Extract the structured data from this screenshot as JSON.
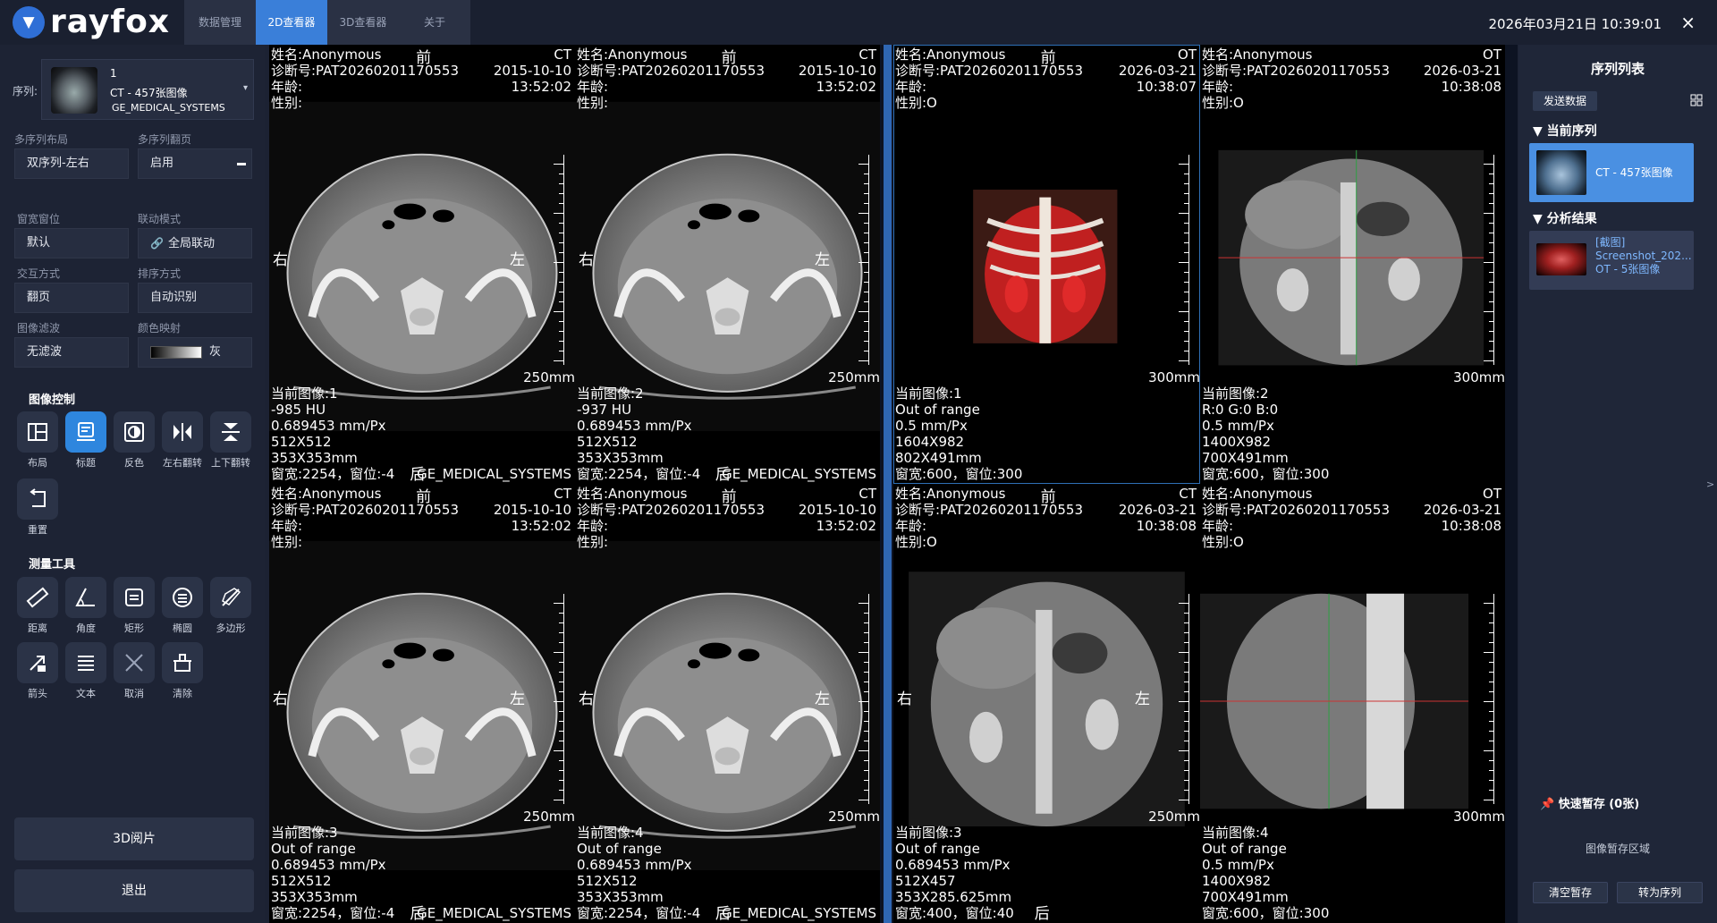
{
  "header": {
    "app_name": "rayfox",
    "tabs": [
      {
        "label": "数据管理"
      },
      {
        "label": "2D查看器"
      },
      {
        "label": "3D查看器"
      },
      {
        "label": "关于"
      }
    ],
    "datetime": "2026年03月21日 10:39:01",
    "close_label": "×"
  },
  "left": {
    "series_label": "序列:",
    "series_number": "1",
    "series_name": "CT - 457张图像",
    "series_vendor": "GE_MEDICAL_SYSTEMS",
    "fields": {
      "multi_layout_label": "多序列布局",
      "multi_layout_value": "双序列-左右",
      "multi_page_label": "多序列翻页",
      "multi_page_value": "启用",
      "window_label": "窗宽窗位",
      "window_value": "默认",
      "link_label": "联动模式",
      "link_value": "全局联动",
      "interact_label": "交互方式",
      "interact_value": "翻页",
      "sort_label": "排序方式",
      "sort_value": "自动识别",
      "filter_label": "图像滤波",
      "filter_value": "无滤波",
      "colormap_label": "颜色映射",
      "colormap_value": "灰"
    },
    "image_control_title": "图像控制",
    "image_tools": [
      {
        "label": "布局",
        "icon": "layout-icon"
      },
      {
        "label": "标题",
        "icon": "caption-icon"
      },
      {
        "label": "反色",
        "icon": "invert-icon"
      },
      {
        "label": "左右翻转",
        "icon": "flip-horizontal-icon"
      },
      {
        "label": "上下翻转",
        "icon": "flip-vertical-icon"
      },
      {
        "label": "重置",
        "icon": "reset-icon"
      }
    ],
    "measure_title": "测量工具",
    "measure_tools": [
      {
        "label": "距离",
        "icon": "ruler-icon"
      },
      {
        "label": "角度",
        "icon": "angle-icon"
      },
      {
        "label": "矩形",
        "icon": "rectangle-icon"
      },
      {
        "label": "椭圆",
        "icon": "ellipse-icon"
      },
      {
        "label": "多边形",
        "icon": "polygon-icon"
      },
      {
        "label": "箭头",
        "icon": "arrow-icon"
      },
      {
        "label": "文本",
        "icon": "text-icon"
      },
      {
        "label": "取消",
        "icon": "cancel-icon"
      },
      {
        "label": "清除",
        "icon": "clear-icon"
      }
    ],
    "btn_3d": "3D阅片",
    "btn_exit": "退出"
  },
  "viewports": [
    {
      "tl1": "姓名:Anonymous",
      "tl2": "诊断号:PAT20260201170553",
      "tl3": "年龄:",
      "tl4": "性别:",
      "top": "前",
      "tr1": "CT",
      "tr2": "2015-10-10",
      "tr3": "13:52:02",
      "left": "右",
      "right": "左",
      "scale_label": "250mm",
      "bl1": "当前图像:1",
      "bl2": "-985 HU",
      "bl3": "0.689453 mm/Px",
      "bl4": "512X512",
      "bl5": "353X353mm",
      "bl6": "窗宽:2254，窗位:-4",
      "bottom": "后",
      "br1": "GE_MEDICAL_SYSTEMS"
    },
    {
      "tl1": "姓名:Anonymous",
      "tl2": "诊断号:PAT20260201170553",
      "tl3": "年龄:",
      "tl4": "性别:",
      "top": "前",
      "tr1": "CT",
      "tr2": "2015-10-10",
      "tr3": "13:52:02",
      "left": "右",
      "right": "左",
      "scale_label": "250mm",
      "bl1": "当前图像:2",
      "bl2": "-937 HU",
      "bl3": "0.689453 mm/Px",
      "bl4": "512X512",
      "bl5": "353X353mm",
      "bl6": "窗宽:2254，窗位:-4",
      "bottom": "后",
      "br1": "GE_MEDICAL_SYSTEMS"
    },
    {
      "tl1": "姓名:Anonymous",
      "tl2": "诊断号:PAT20260201170553",
      "tl3": "年龄:",
      "tl4": "性别:O",
      "top": "前",
      "tr1": "OT",
      "tr2": "2026-03-21",
      "tr3": "10:38:07",
      "left": "",
      "right": "",
      "scale_label": "300mm",
      "bl1": "当前图像:1",
      "bl2": "Out of range",
      "bl3": "0.5 mm/Px",
      "bl4": "1604X982",
      "bl5": "802X491mm",
      "bl6": "窗宽:600，窗位:300",
      "bottom": "",
      "br1": ""
    },
    {
      "tl1": "姓名:Anonymous",
      "tl2": "诊断号:PAT20260201170553",
      "tl3": "年龄:",
      "tl4": "性别:O",
      "top": "",
      "tr1": "OT",
      "tr2": "2026-03-21",
      "tr3": "10:38:08",
      "left": "",
      "right": "",
      "scale_label": "300mm",
      "bl1": "当前图像:2",
      "bl2": "R:0 G:0 B:0",
      "bl3": "0.5 mm/Px",
      "bl4": "1400X982",
      "bl5": "700X491mm",
      "bl6": "窗宽:600，窗位:300",
      "bottom": "",
      "br1": ""
    },
    {
      "tl1": "姓名:Anonymous",
      "tl2": "诊断号:PAT20260201170553",
      "tl3": "年龄:",
      "tl4": "性别:",
      "top": "前",
      "tr1": "CT",
      "tr2": "2015-10-10",
      "tr3": "13:52:02",
      "left": "右",
      "right": "左",
      "scale_label": "250mm",
      "bl1": "当前图像:3",
      "bl2": "Out of range",
      "bl3": "0.689453 mm/Px",
      "bl4": "512X512",
      "bl5": "353X353mm",
      "bl6": "窗宽:2254，窗位:-4",
      "bottom": "后",
      "br1": "GE_MEDICAL_SYSTEMS"
    },
    {
      "tl1": "姓名:Anonymous",
      "tl2": "诊断号:PAT20260201170553",
      "tl3": "年龄:",
      "tl4": "性别:",
      "top": "前",
      "tr1": "CT",
      "tr2": "2015-10-10",
      "tr3": "13:52:02",
      "left": "右",
      "right": "左",
      "scale_label": "250mm",
      "bl1": "当前图像:4",
      "bl2": "Out of range",
      "bl3": "0.689453 mm/Px",
      "bl4": "512X512",
      "bl5": "353X353mm",
      "bl6": "窗宽:2254，窗位:-4",
      "bottom": "后",
      "br1": "GE_MEDICAL_SYSTEMS"
    },
    {
      "tl1": "姓名:Anonymous",
      "tl2": "诊断号:PAT20260201170553",
      "tl3": "年龄:",
      "tl4": "性别:O",
      "top": "前",
      "tr1": "CT",
      "tr2": "2026-03-21",
      "tr3": "10:38:08",
      "left": "右",
      "right": "左",
      "scale_label": "250mm",
      "bl1": "当前图像:3",
      "bl2": "Out of range",
      "bl3": "0.689453 mm/Px",
      "bl4": "512X457",
      "bl5": "353X285.625mm",
      "bl6": "窗宽:400，窗位:40",
      "bottom": "后",
      "br1": ""
    },
    {
      "tl1": "姓名:Anonymous",
      "tl2": "诊断号:PAT20260201170553",
      "tl3": "年龄:",
      "tl4": "性别:O",
      "top": "",
      "tr1": "OT",
      "tr2": "2026-03-21",
      "tr3": "10:38:08",
      "left": "",
      "right": "",
      "scale_label": "300mm",
      "bl1": "当前图像:4",
      "bl2": "Out of range",
      "bl3": "0.5 mm/Px",
      "bl4": "1400X982",
      "bl5": "700X491mm",
      "bl6": "窗宽:600，窗位:300",
      "bottom": "",
      "br1": ""
    }
  ],
  "right": {
    "title": "序列列表",
    "send_label": "发送数据",
    "current_series_head": "▼ 当前序列",
    "current_series_item": "CT - 457张图像",
    "analysis_head": "▼ 分析结果",
    "analysis_line1": "[截图]",
    "analysis_line2": "Screenshot_202...",
    "analysis_line3": "OT - 5张图像",
    "quick_save": "快速暂存 (0张)",
    "save_area": "图像暂存区域",
    "clear_btn": "清空暂存",
    "to_series_btn": "转为序列"
  },
  "colors": {
    "accent": "#2e86de",
    "tab_active": "#3a7fd9",
    "panel_bg": "#1d2334",
    "viewer_bg": "#000000"
  }
}
